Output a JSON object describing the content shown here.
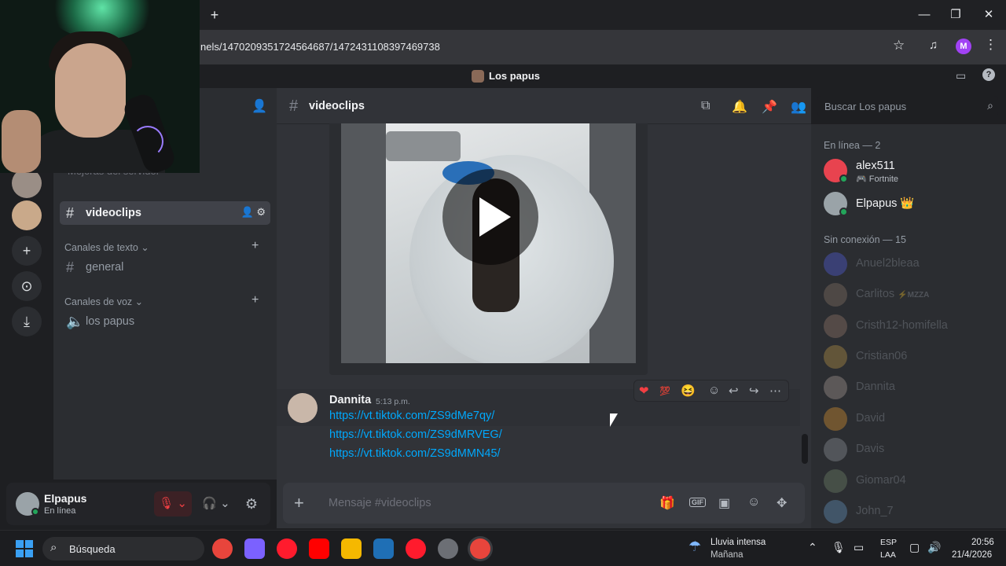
{
  "browser": {
    "url": "nels/1470209351724564687/1472431108397469738",
    "profile_initial": "M",
    "new_tab": "+",
    "window_controls": [
      "—",
      "❐",
      "✕"
    ]
  },
  "discord": {
    "server_name": "Los papus",
    "channel_header": "videoclips",
    "search_placeholder": "Buscar Los papus"
  },
  "sidebar": {
    "faded_item": "Mejoras del servidor",
    "active_channel": "videoclips",
    "categories": [
      {
        "label": "Canales de texto ⌄",
        "channels": [
          "general"
        ]
      },
      {
        "label": "Canales de voz ⌄",
        "channels": [
          "los papus"
        ]
      }
    ]
  },
  "user_panel": {
    "name": "Elpapus",
    "status": "En línea"
  },
  "message": {
    "author": "Dannita",
    "time": "5:13 p.m.",
    "links": [
      "https://vt.tiktok.com/ZS9dMe7qy/",
      "https://vt.tiktok.com/ZS9dMRVEG/",
      "https://vt.tiktok.com/ZS9dMMN45/"
    ]
  },
  "composer": {
    "placeholder": "Mensaje #videoclips",
    "gif_label": "GIF"
  },
  "members": {
    "online_header": "En línea — 2",
    "offline_header": "Sin conexión — 15",
    "online": [
      {
        "name": "alex511",
        "activity": "🎮 Fortnite",
        "color": "#e8434f"
      },
      {
        "name": "Elpapus 👑",
        "activity": "",
        "color": "#9aa3a8"
      }
    ],
    "offline": [
      {
        "name": "Anuel2bleaa",
        "tag": "",
        "color": "#5865f2"
      },
      {
        "name": "Carlitos",
        "tag": "⚡MZZA",
        "color": "#8f7a6a"
      },
      {
        "name": "Cristh12-homifella",
        "tag": "",
        "color": "#a08070"
      },
      {
        "name": "Cristian06",
        "tag": "",
        "color": "#c9a14a"
      },
      {
        "name": "Dannita",
        "tag": "",
        "color": "#b8a9a0"
      },
      {
        "name": "David",
        "tag": "",
        "color": "#f0a030"
      },
      {
        "name": "Davis",
        "tag": "",
        "color": "#9aa0a6"
      },
      {
        "name": "Giomar04",
        "tag": "",
        "color": "#7a8f70"
      },
      {
        "name": "John_7",
        "tag": "",
        "color": "#6a9fd0"
      }
    ]
  },
  "taskbar": {
    "search_label": "Búsqueda",
    "weather_title": "Lluvia intensa",
    "weather_sub": "Mañana",
    "lang_top": "ESP",
    "lang_bottom": "LAA",
    "time": "20:56",
    "date": "21/4/2026"
  }
}
